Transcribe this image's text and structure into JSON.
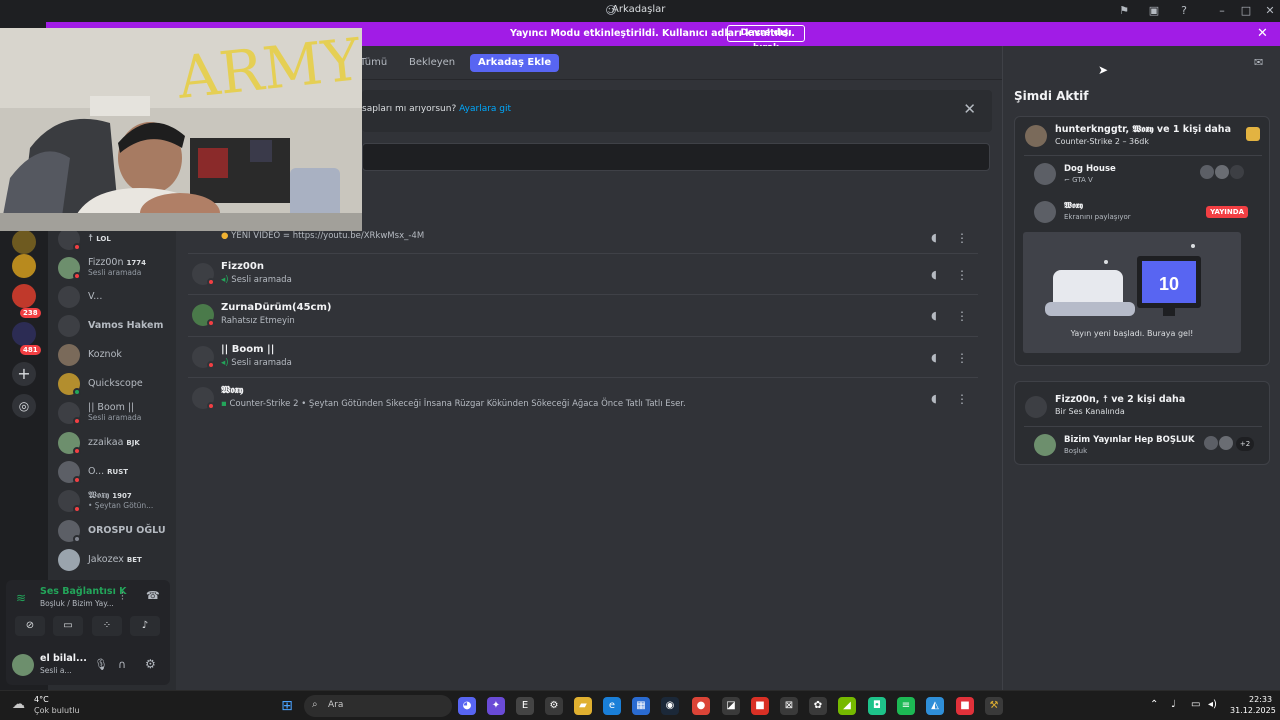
{
  "window": {
    "title": "Arkadaşlar"
  },
  "banner": {
    "message": "Yayıncı Modu etkinleştirildi. Kullanıcı adları kısaltıldı.",
    "button_label": "Devre dışı bırak"
  },
  "rail": {
    "badges": [
      "238",
      "481"
    ]
  },
  "sidebar": {
    "items": [
      {
        "name": "☨",
        "tag": "LOL",
        "sub": ""
      },
      {
        "name": "Fizz00n",
        "tag": "1774",
        "sub": "Sesli aramada"
      },
      {
        "name": "V...",
        "tag": "",
        "sub": ""
      },
      {
        "name": "Vamos Hakem",
        "tag": "",
        "sub": ""
      },
      {
        "name": "Koznok",
        "tag": "",
        "sub": ""
      },
      {
        "name": "Quickscope",
        "tag": "",
        "sub": ""
      },
      {
        "name": "|| Boom ||",
        "tag": "",
        "sub": "Sesli aramada"
      },
      {
        "name": "zzaikaa",
        "tag": "BJK",
        "sub": ""
      },
      {
        "name": "O...",
        "tag": "RUST",
        "sub": ""
      },
      {
        "name": "𝖂𝖔𝖝𝖞",
        "tag": "1907",
        "sub": "• Şeytan Götün..."
      },
      {
        "name": "OROSPU OĞLU",
        "tag": "",
        "sub": ""
      },
      {
        "name": "Jakozex",
        "tag": "BET",
        "sub": ""
      }
    ]
  },
  "voice": {
    "status": "Ses Bağlantısı K",
    "channel": "Boşluk / Bizim Yay...",
    "user_name": "el bilal...",
    "user_status": "Sesli a..."
  },
  "header": {
    "tabs": [
      "Tümü",
      "Bekleyen"
    ],
    "add_friend": "Arkadaş Ekle"
  },
  "notice": {
    "text": "sapları mı arıyorsun?",
    "link": "Ayarlara git"
  },
  "friends": [
    {
      "name": "",
      "sub": "YENİ VİDEO = https://youtu.be/XRkwMsx_-4M"
    },
    {
      "name": "Fizz00n",
      "sub": "Sesli aramada"
    },
    {
      "name": "ZurnaDürüm(45cm)",
      "sub": "Rahatsız Etmeyin"
    },
    {
      "name": "|| Boom ||",
      "sub": "Sesli aramada"
    },
    {
      "name": "𝖂𝖔𝖝𝖞",
      "sub": "Counter-Strike 2 • Şeytan Götünden Sikeceği İnsana Rüzgar Kökünden Sökeceği Ağaca Önce Tatlı Tatlı Eser."
    }
  ],
  "active": {
    "title": "Şimdi Aktif",
    "card1": {
      "title": "hunterknggtr, 𝖂𝖔𝖝𝖞 ve 1 kişi daha",
      "subtitle": "Counter-Strike 2 – 36dk",
      "voice_channel": "Dog House",
      "voice_game": "GTA V",
      "streamer": "𝖂𝖔𝖝𝖞",
      "streamer_status": "Ekranını paylaşıyor",
      "live_badge": "YAYINDA",
      "preview_caption": "Yayın yeni başladı. Buraya gel!"
    },
    "card2": {
      "title": "Fizz00n, ☨ ve 2 kişi daha",
      "subtitle": "Bir Ses Kanalında",
      "channel": "Bizim Yayınlar Hep BOŞLUK",
      "server": "Boşluk",
      "extra": "+2"
    }
  },
  "taskbar": {
    "weather_temp": "4°C",
    "weather_desc": "Çok bulutlu",
    "search": "Ara",
    "time": "22:33",
    "date": "31.12.2025"
  },
  "colors": {
    "banner": "#a11ce6",
    "accent": "#5865f2",
    "online": "#23a55a",
    "dnd": "#f23f43"
  }
}
